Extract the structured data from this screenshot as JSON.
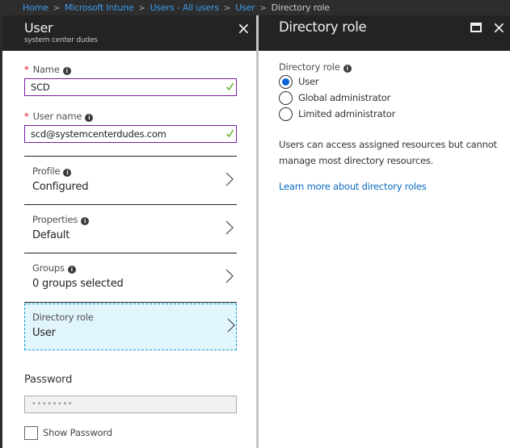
{
  "breadcrumb": {
    "items": [
      "Home",
      "Microsoft Intune",
      "Users - All users",
      "User"
    ],
    "current": "Directory role",
    "separator": ">"
  },
  "user_blade": {
    "title": "User",
    "subtitle": "system center dudes",
    "close_icon": "×",
    "name_field": {
      "label": "Name",
      "required_marker": "*",
      "value": "SCD",
      "valid": true
    },
    "username_field": {
      "label": "User name",
      "required_marker": "*",
      "value": "scd@systemcenterdudes.com",
      "valid": true
    },
    "nav_items": [
      {
        "label": "Profile",
        "value": "Configured",
        "has_info": true
      },
      {
        "label": "Properties",
        "value": "Default",
        "has_info": true
      },
      {
        "label": "Groups",
        "value": "0 groups selected",
        "has_info": true
      },
      {
        "label": "Directory role",
        "value": "User",
        "has_info": false,
        "selected": true
      }
    ],
    "password": {
      "label": "Password",
      "value": "••••••••"
    },
    "show_password": {
      "label": "Show Password",
      "checked": false
    }
  },
  "role_blade": {
    "title": "Directory role",
    "close_icon": "×",
    "field_label": "Directory role",
    "options": [
      {
        "label": "User",
        "selected": true
      },
      {
        "label": "Global administrator",
        "selected": false
      },
      {
        "label": "Limited administrator",
        "selected": false
      }
    ],
    "description": "Users can access assigned resources but cannot manage most directory resources.",
    "learn_more": "Learn more about directory roles"
  },
  "info_glyph": "i",
  "colors": {
    "accent_link": "#0b6ac3",
    "valid_check": "#6cb23a",
    "input_border": "#7a1fa2",
    "selected_bg": "#e1f5fc",
    "required": "#e81123"
  }
}
